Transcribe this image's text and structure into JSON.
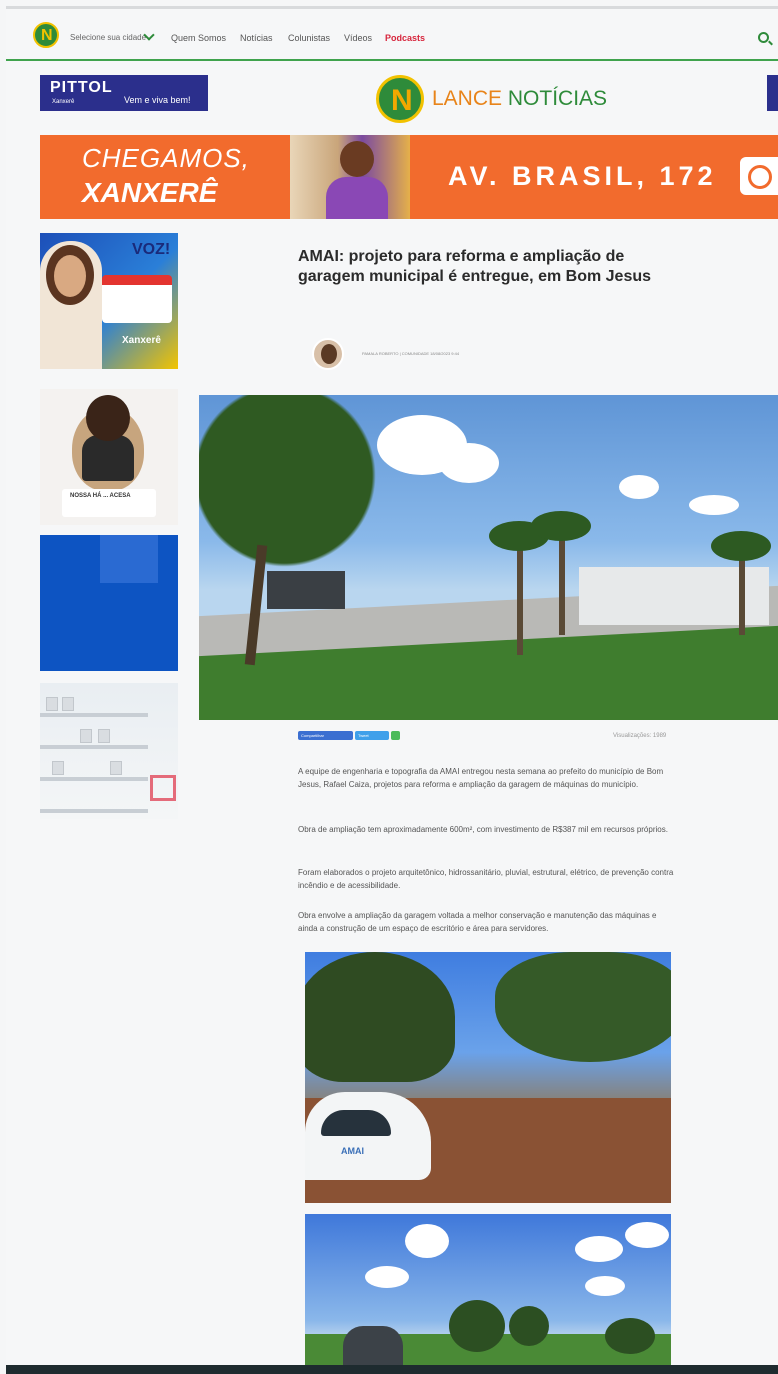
{
  "nav": {
    "logo_letter": "N",
    "city_selector": "Selecione sua cidade",
    "items": [
      "Quem Somos",
      "Notícias",
      "Colunistas",
      "Vídeos",
      "Podcasts"
    ]
  },
  "header": {
    "ad_left": {
      "brand": "PITTOL",
      "city": "Xanxerê",
      "slogan": "Vem e viva bem!"
    },
    "logo_letter": "N",
    "brand_part1": "LANCE",
    "brand_part2": "NOTÍCIAS"
  },
  "banner": {
    "line1": "CHEGAMOS,",
    "line2": "XANXERÊ",
    "address": "AV. BRASIL, 172"
  },
  "sidebar": {
    "ad1": {
      "headline": "VOZ!",
      "city": "Xanxerê"
    },
    "ad2": {
      "card_text": "NOSSA HÁ ... ACESA"
    }
  },
  "article": {
    "title": "AMAI: projeto para reforma e ampliação de garagem municipal é entregue, em Bom Jesus",
    "meta": "PAMALA ROBERTO | COMUNIDADE 18/08/2023 9:44",
    "share": {
      "facebook": "Compartilhar",
      "twitter": "Tweet"
    },
    "views": "Visualizações: 1989",
    "paragraphs": [
      "A equipe de engenharia e topografia da AMAI entregou nesta semana ao prefeito do município de Bom Jesus, Rafael Caiza, projetos para reforma e ampliação da garagem de máquinas do município.",
      "Obra de ampliação tem aproximadamente 600m², com investimento de R$387 mil em recursos próprios.",
      "Foram elaborados o projeto arquitetônico, hidrossanitário, pluvial, estrutural, elétrico, de prevenção contra incêndio e de acessibilidade.",
      "Obra envolve a ampliação da garagem voltada a melhor conservação e manutenção das máquinas e ainda a construção de um espaço de escritório e área para servidores."
    ],
    "photo_car_label": "AMAI"
  },
  "colors": {
    "brand_green": "#2e8b3a",
    "brand_orange": "#e8841a",
    "podcast_red": "#d7263d",
    "banner_orange": "#f26b2d",
    "ad_navy": "#2b2f8c"
  }
}
